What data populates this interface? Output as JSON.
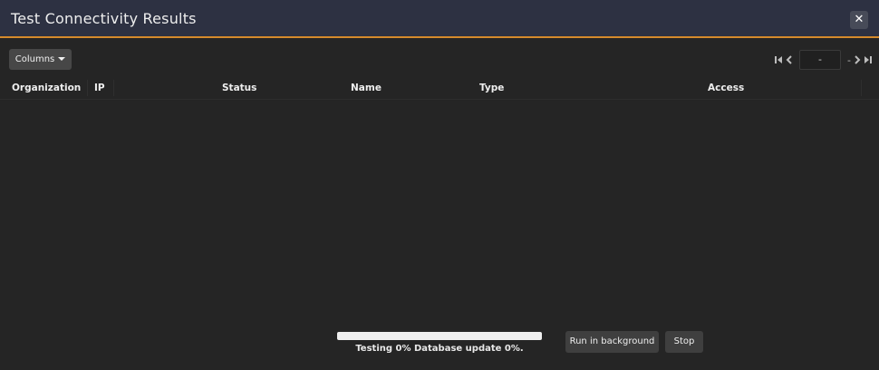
{
  "window": {
    "title": "Test Connectivity Results",
    "close_glyph": "✕"
  },
  "toolbar": {
    "columns_label": "Columns"
  },
  "pager": {
    "page_value": "-",
    "separator": "-"
  },
  "table": {
    "columns": [
      "Organization",
      "IP",
      "Status",
      "Name",
      "Type",
      "Access"
    ],
    "rows": []
  },
  "progress": {
    "percent": 0,
    "text": "Testing 0% Database update 0%."
  },
  "footer": {
    "run_background_label": "Run in background",
    "stop_label": "Stop"
  },
  "colors": {
    "background": "#252525",
    "titlebar": "#2d3142",
    "accent": "#d58a2c"
  },
  "icons": [
    "close-icon",
    "caret-down-icon",
    "first-page-icon",
    "prev-page-icon",
    "next-page-icon",
    "last-page-icon"
  ]
}
